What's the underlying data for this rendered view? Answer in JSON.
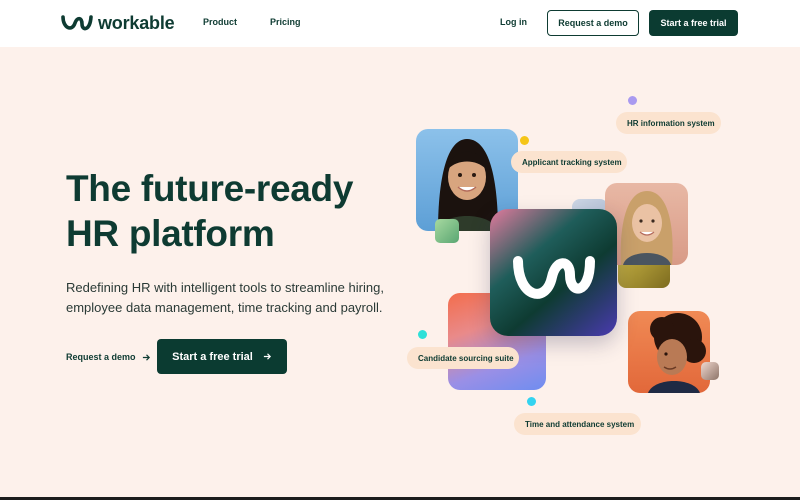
{
  "brand": {
    "name": "workable"
  },
  "nav": {
    "product": "Product",
    "pricing": "Pricing",
    "login": "Log in",
    "request_demo": "Request a demo",
    "free_trial": "Start a free trial"
  },
  "hero": {
    "title_line1": "The future-ready",
    "title_line2": "HR platform",
    "subtitle_line1": "Redefining HR with intelligent tools to streamline hiring,",
    "subtitle_line2": "employee data management, time tracking and payroll.",
    "demo_link": "Request a demo",
    "cta": "Start a free trial"
  },
  "features": {
    "hr_info": "HR information system",
    "ats": "Applicant tracking system",
    "sourcing": "Candidate sourcing suite",
    "time": "Time and attendance system"
  },
  "colors": {
    "brand_green": "#0b3b31",
    "hero_bg": "#fdf1eb",
    "pill_bg": "#fbe3cf"
  },
  "icons": {
    "arrow": "arrow-right-icon",
    "logo": "workable-w-logo-icon"
  }
}
